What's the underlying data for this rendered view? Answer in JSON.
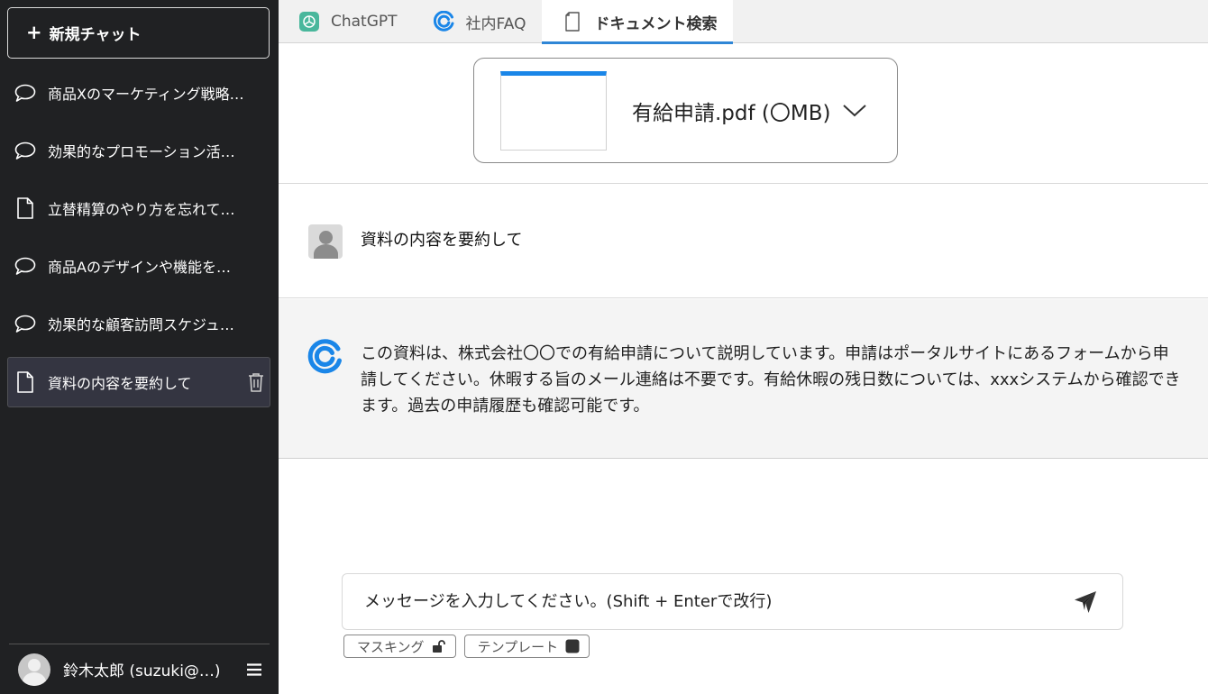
{
  "sidebar": {
    "new_chat_label": "新規チャット",
    "history": [
      {
        "label": "商品Xのマーケティング戦略…",
        "icon": "chat-bubble-icon"
      },
      {
        "label": "効果的なプロモーション活…",
        "icon": "chat-bubble-icon"
      },
      {
        "label": "立替精算のやり方を忘れて…",
        "icon": "document-icon"
      },
      {
        "label": "商品Aのデザインや機能を…",
        "icon": "chat-bubble-icon"
      },
      {
        "label": "効果的な顧客訪問スケジュ…",
        "icon": "chat-bubble-icon"
      },
      {
        "label": "資料の内容を要約して",
        "icon": "document-icon",
        "active": true
      }
    ],
    "user_name": "鈴木太郎 (suzuki@…)"
  },
  "tabs": [
    {
      "label": "ChatGPT",
      "icon": "openai-icon"
    },
    {
      "label": "社内FAQ",
      "icon": "brand-c-icon"
    },
    {
      "label": "ドキュメント検索",
      "icon": "document-icon",
      "active": true
    }
  ],
  "file": {
    "name": "有給申請.pdf (〇MB)"
  },
  "messages": {
    "user": "資料の内容を要約して",
    "assistant": "この資料は、株式会社〇〇での有給申請について説明しています。申請はポータルサイトにあるフォームから申請してください。休暇する旨のメール連絡は不要です。有給休暇の残日数については、xxxシステムから確認できます。過去の申請履歴も確認可能です。"
  },
  "input": {
    "placeholder": "メッセージを入力してください。(Shift + Enterで改行)"
  },
  "chips": {
    "masking": "マスキング",
    "template": "テンプレート"
  },
  "colors": {
    "sidebar_bg": "#202123",
    "accent_blue": "#1a86e8",
    "openai_green": "#10a37f"
  }
}
